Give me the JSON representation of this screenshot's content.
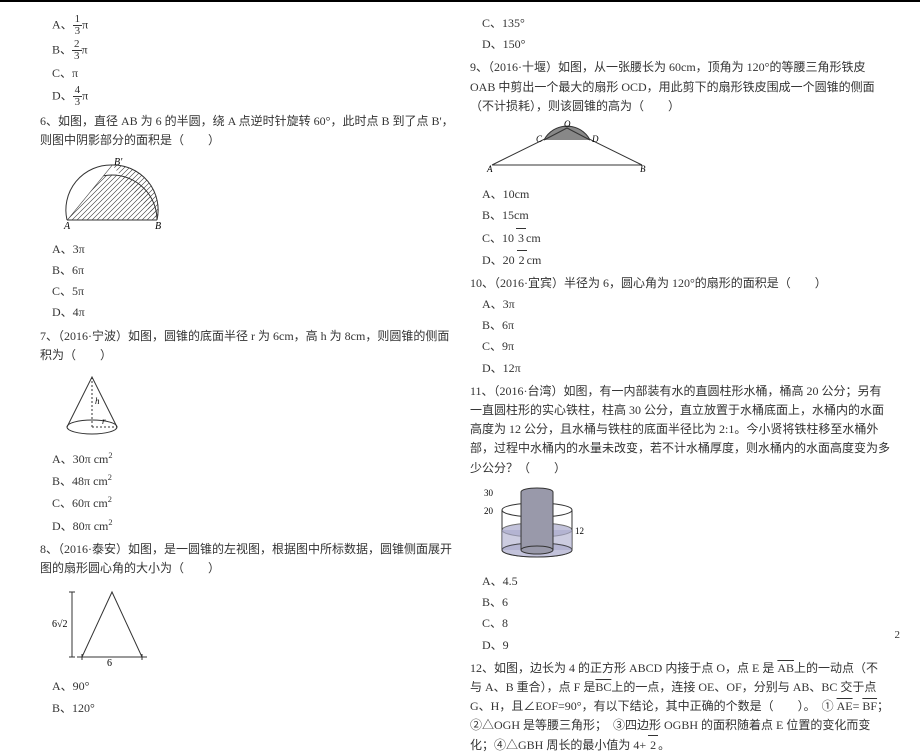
{
  "left": {
    "q5": {
      "a": "π",
      "b": "π",
      "c": "π",
      "d": "π",
      "frac_a_n": "1",
      "frac_a_d": "3",
      "frac_b_n": "2",
      "frac_b_d": "3",
      "frac_d_n": "4",
      "frac_d_d": "3"
    },
    "q6": {
      "stem": "6、如图，直径 AB 为 6 的半圆，绕 A 点逆时针旋转 60°，此时点 B 到了点 B'，则图中阴影部分的面积是（　　）",
      "a": "A、3π",
      "b": "B、6π",
      "c": "C、5π",
      "d": "D、4π"
    },
    "q7": {
      "stem": "7、（2016·宁波）如图，圆锥的底面半径 r 为 6cm，高 h 为 8cm，则圆锥的侧面积为（　　）",
      "a": "A、30π cm",
      "b": "B、48π cm",
      "c": "C、60π cm",
      "d": "D、80π cm",
      "sup": "2"
    },
    "q8": {
      "stem": "8、（2016·泰安）如图，是一圆锥的左视图，根据图中所标数据，圆锥侧面展开图的扇形圆心角的大小为（　　）",
      "a": "A、90°",
      "b": "B、120°",
      "sidelabel": "6√2",
      "baselabel": "6"
    }
  },
  "right": {
    "q8": {
      "c": "C、135°",
      "d": "D、150°"
    },
    "q9": {
      "stem": "9、（2016·十堰）如图，从一张腰长为 60cm，顶角为 120°的等腰三角形铁皮 OAB 中剪出一个最大的扇形 OCD，用此剪下的扇形铁皮围成一个圆锥的侧面（不计损耗），则该圆锥的高为（　　）",
      "a": "A、10cm",
      "b": "B、15cm",
      "c_pre": "C、10",
      "c_sqrt": "3",
      "c_post": "cm",
      "d_pre": "D、20",
      "d_sqrt": "2",
      "d_post": "cm"
    },
    "q10": {
      "stem": "10、（2016·宜宾）半径为 6，圆心角为 120°的扇形的面积是（　　）",
      "a": "A、3π",
      "b": "B、6π",
      "c": "C、9π",
      "d": "D、12π"
    },
    "q11": {
      "stem": "11、（2016·台湾）如图，有一内部装有水的直圆柱形水桶，桶高 20 公分；另有一直圆柱形的实心铁柱，柱高 30 公分，直立放置于水桶底面上，水桶内的水面高度为 12 公分，且水桶与铁柱的底面半径比为 2:1。今小贤将铁柱移至水桶外部，过程中水桶内的水量未改变，若不计水桶厚度，则水桶内的水面高度变为多少公分？（　　）",
      "a": "A、4.5",
      "b": "B、6",
      "c": "C、8",
      "d": "D、9",
      "label30": "30",
      "label20": "20",
      "label12": "12"
    },
    "q12": {
      "stem1": "12、如图，边长为 4 的正方形 ABCD 内接于点 O，点 E 是 ",
      "arc_ab": "AB",
      "stem2": "上的一动点（不与 A、B 重合），点 F 是",
      "arc_bc": "BC",
      "stem3": "上的一点，连接 OE、OF，分别与 AB、BC 交于点 G、H，且∠EOF=90°，有以下结论，其中正确的个数是（　　）。　① ",
      "arc_ae": "AE",
      "eq": "= ",
      "arc_bf": "BF",
      "stem4": "；　②△OGH 是等腰三角形；　③四边形 OGBH 的面积随着点 E 位置的变化而变化；④△GBH 周长的最小值为 4+",
      "sqrt2": "2",
      "stem5": "。"
    }
  },
  "pagenum": "2"
}
